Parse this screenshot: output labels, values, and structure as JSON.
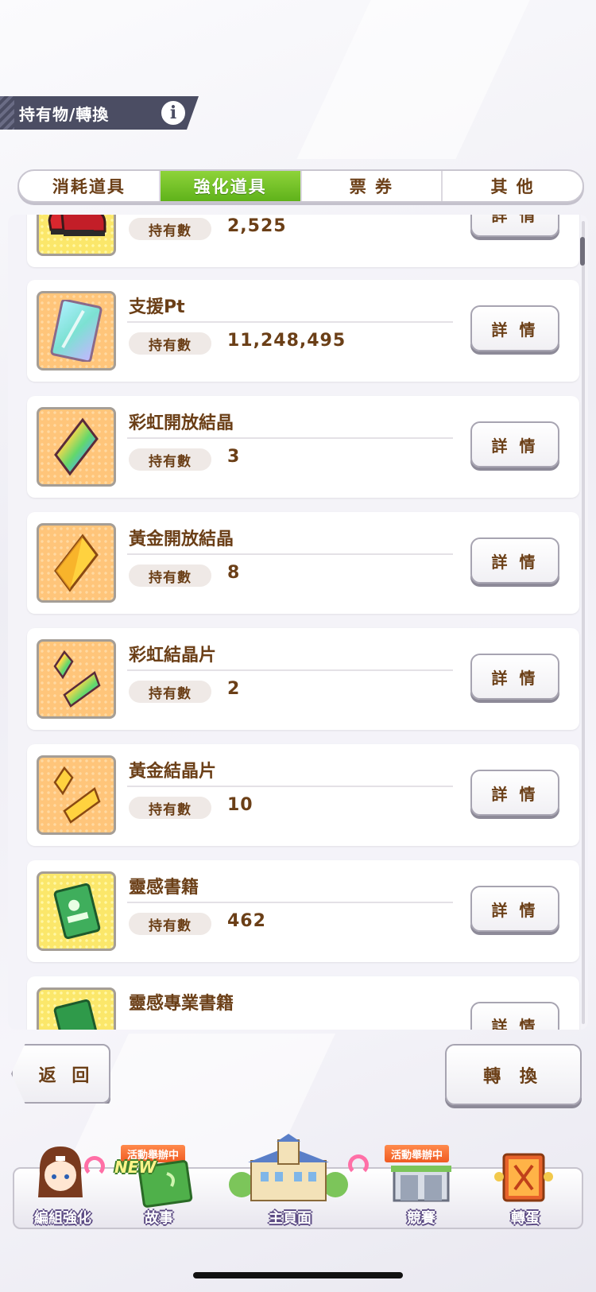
{
  "header": {
    "title": "持有物/轉換",
    "info_icon": "i"
  },
  "tabs": [
    {
      "label": "消耗道具",
      "active": false
    },
    {
      "label": "強化道具",
      "active": true
    },
    {
      "label": "票 券",
      "active": false
    },
    {
      "label": "其 他",
      "active": false
    }
  ],
  "own_label": "持有數",
  "detail_label": "詳 情",
  "items": [
    {
      "name": "",
      "value": "2,525",
      "icon": "running-shoes-icon"
    },
    {
      "name": "支援Pt",
      "value": "11,248,495",
      "icon": "support-pt-card-icon"
    },
    {
      "name": "彩虹開放結晶",
      "value": "3",
      "icon": "rainbow-crystal-icon"
    },
    {
      "name": "黃金開放結晶",
      "value": "8",
      "icon": "gold-crystal-icon"
    },
    {
      "name": "彩虹結晶片",
      "value": "2",
      "icon": "rainbow-shard-icon"
    },
    {
      "name": "黃金結晶片",
      "value": "10",
      "icon": "gold-shard-icon"
    },
    {
      "name": "靈感書籍",
      "value": "462",
      "icon": "inspiration-book-icon"
    },
    {
      "name": "靈感專業書籍",
      "value": "",
      "icon": "pro-book-icon"
    }
  ],
  "buttons": {
    "back": "返 回",
    "convert": "轉 換"
  },
  "nav": {
    "items": [
      {
        "label": "編組強化",
        "icon": "character-icon"
      },
      {
        "label": "故事",
        "icon": "story-book-icon",
        "badge": "NEW",
        "banner": "活動舉辦中"
      },
      {
        "label": "主頁面",
        "icon": "school-building-icon"
      },
      {
        "label": "競賽",
        "icon": "race-gate-icon",
        "banner": "活動舉辦中"
      },
      {
        "label": "轉蛋",
        "icon": "gacha-door-icon"
      }
    ]
  },
  "colors": {
    "accent_green": "#6cc024",
    "text_brown": "#6b3f17",
    "header_bg": "#4b4d63"
  }
}
